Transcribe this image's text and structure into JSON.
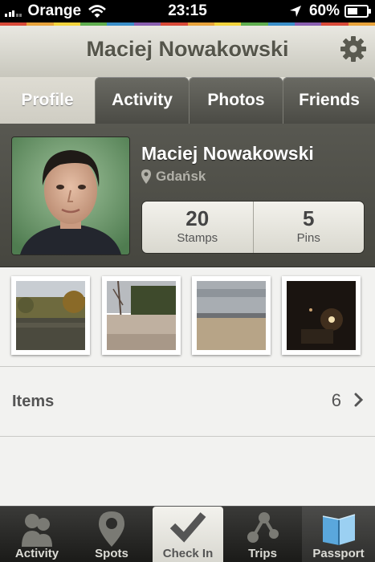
{
  "status_bar": {
    "carrier": "Orange",
    "time": "23:15",
    "battery": "60%",
    "battery_level": 0.6
  },
  "stripe_colors": [
    "#d94a38",
    "#e8a33a",
    "#f2d33b",
    "#5fae4f",
    "#3a8fc9",
    "#8a5fb0",
    "#d94a38",
    "#e8a33a",
    "#f2d33b",
    "#5fae4f",
    "#3a8fc9",
    "#8a5fb0",
    "#d94a38",
    "#e8a33a"
  ],
  "header": {
    "title": "Maciej Nowakowski",
    "settings_icon": "gear-icon"
  },
  "tabs": [
    {
      "label": "Profile",
      "active": true
    },
    {
      "label": "Activity",
      "active": false
    },
    {
      "label": "Photos",
      "active": false
    },
    {
      "label": "Friends",
      "active": false
    }
  ],
  "profile": {
    "name": "Maciej Nowakowski",
    "location": "Gdańsk",
    "stats": [
      {
        "value": "20",
        "label": "Stamps"
      },
      {
        "value": "5",
        "label": "Pins"
      }
    ]
  },
  "items": {
    "label": "Items",
    "count": "6"
  },
  "tab_bar": [
    {
      "label": "Activity",
      "icon": "people-icon"
    },
    {
      "label": "Spots",
      "icon": "map-pin-icon"
    },
    {
      "label": "Check In",
      "icon": "checkmark-icon"
    },
    {
      "label": "Trips",
      "icon": "route-icon"
    },
    {
      "label": "Passport",
      "icon": "passport-book-icon"
    }
  ]
}
